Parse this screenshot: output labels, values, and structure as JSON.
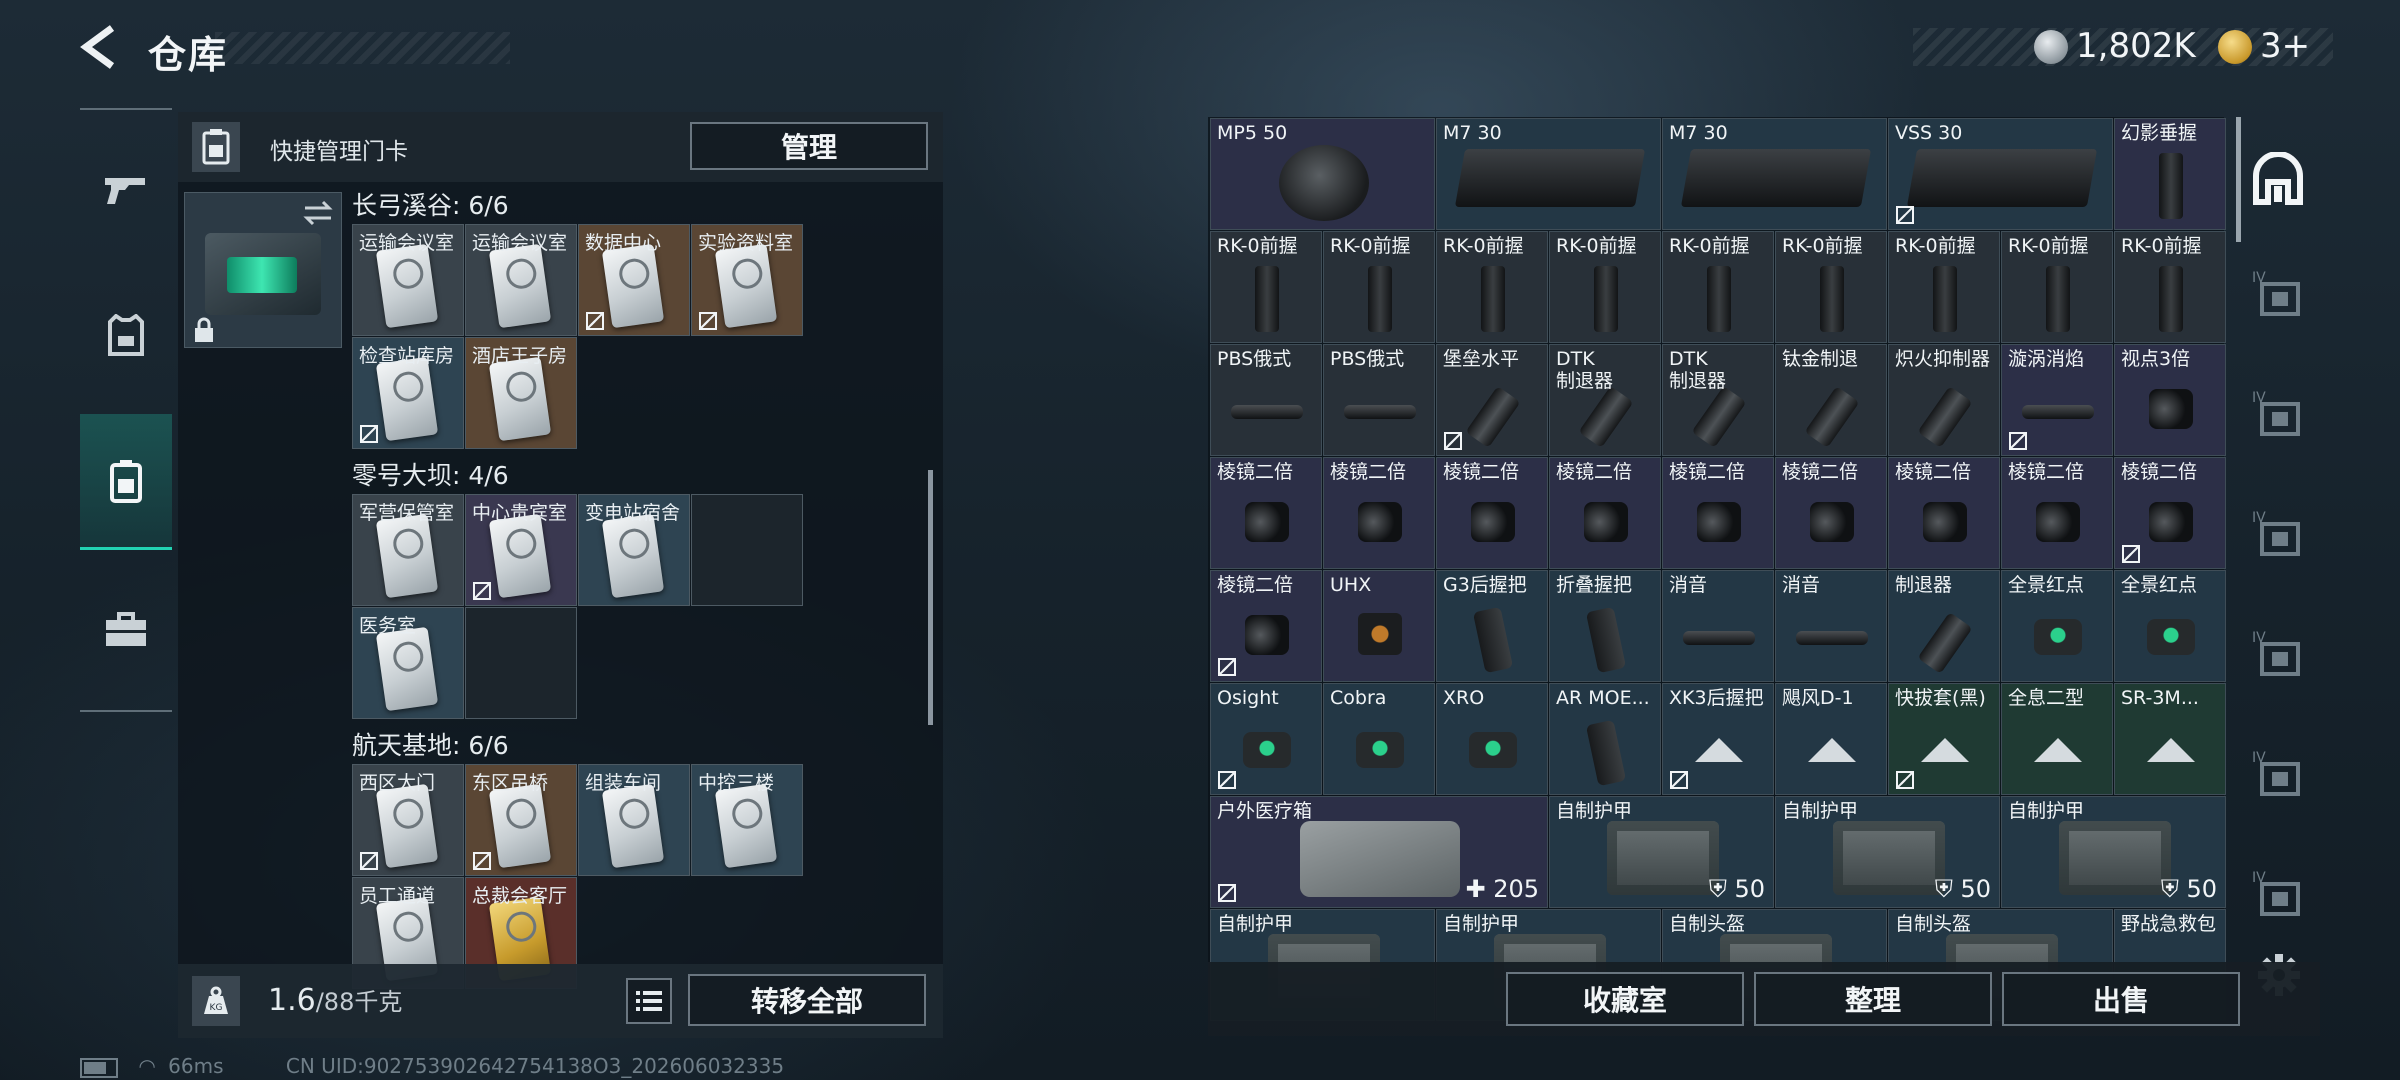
{
  "header": {
    "title": "仓库"
  },
  "currency": {
    "main": "1,802K",
    "tokens": "3+"
  },
  "left_panel": {
    "manage_label": "快捷管理门卡",
    "manage_button": "管理",
    "groups": [
      {
        "title": "长弓溪谷: 6/6",
        "cards": [
          {
            "label": "运输会议室",
            "tint": "gray",
            "locked": false
          },
          {
            "label": "运输会议室",
            "tint": "gray",
            "locked": false
          },
          {
            "label": "数据中心",
            "tint": "brown",
            "locked": true
          },
          {
            "label": "实验资料室",
            "tint": "brown",
            "locked": true
          },
          {
            "label": "检查站库房",
            "tint": "blue",
            "locked": true
          },
          {
            "label": "酒店王子房",
            "tint": "brown",
            "locked": false
          }
        ]
      },
      {
        "title": "零号大坝: 4/6",
        "cards": [
          {
            "label": "军营保管室",
            "tint": "gray",
            "locked": false
          },
          {
            "label": "中心贵宾室",
            "tint": "purple",
            "locked": true
          },
          {
            "label": "变电站宿舍",
            "tint": "blue",
            "locked": false
          },
          {
            "label": "",
            "tint": "empty",
            "locked": false
          },
          {
            "label": "医务室",
            "tint": "blue",
            "locked": false
          },
          {
            "label": "",
            "tint": "empty",
            "locked": false
          }
        ]
      },
      {
        "title": "航天基地: 6/6",
        "cards": [
          {
            "label": "西区大门",
            "tint": "gray",
            "locked": true
          },
          {
            "label": "东区吊桥",
            "tint": "brown",
            "locked": true
          },
          {
            "label": "组装车间",
            "tint": "blue",
            "locked": false
          },
          {
            "label": "中控三楼",
            "tint": "blue",
            "locked": false
          },
          {
            "label": "员工通道",
            "tint": "gray",
            "locked": false
          },
          {
            "label": "总裁会客厅",
            "tint": "red",
            "locked": false,
            "gold": true
          }
        ]
      }
    ],
    "weight_value": "1.6",
    "weight_cap": "/88千克",
    "transfer_all": "转移全部"
  },
  "grid": {
    "rows": [
      [
        {
          "label": "MP5 50",
          "bg": "purple",
          "locked": false,
          "span": 2,
          "obj": "drum"
        },
        {
          "label": "M7 30",
          "bg": "blue",
          "locked": false,
          "span": 2,
          "obj": "mag"
        },
        {
          "label": "M7 30",
          "bg": "blue",
          "locked": false,
          "span": 2,
          "obj": "mag"
        },
        {
          "label": "VSS 30",
          "bg": "blue",
          "locked": true,
          "span": 2,
          "obj": "mag"
        },
        {
          "label": "幻影垂握",
          "bg": "purple",
          "locked": false,
          "span": 1,
          "obj": "grip"
        }
      ],
      [
        {
          "label": "RK-0前握",
          "bg": "gray",
          "locked": false,
          "span": 1,
          "obj": "grip"
        },
        {
          "label": "RK-0前握",
          "bg": "gray",
          "locked": false,
          "span": 1,
          "obj": "grip"
        },
        {
          "label": "RK-0前握",
          "bg": "gray",
          "locked": false,
          "span": 1,
          "obj": "grip"
        },
        {
          "label": "RK-0前握",
          "bg": "gray",
          "locked": false,
          "span": 1,
          "obj": "grip"
        },
        {
          "label": "RK-0前握",
          "bg": "gray",
          "locked": false,
          "span": 1,
          "obj": "grip"
        },
        {
          "label": "RK-0前握",
          "bg": "gray",
          "locked": false,
          "span": 1,
          "obj": "grip"
        },
        {
          "label": "RK-0前握",
          "bg": "gray",
          "locked": false,
          "span": 1,
          "obj": "grip"
        },
        {
          "label": "RK-0前握",
          "bg": "gray",
          "locked": false,
          "span": 1,
          "obj": "grip"
        },
        {
          "label": "RK-0前握",
          "bg": "gray",
          "locked": false,
          "span": 1,
          "obj": "grip"
        }
      ],
      [
        {
          "label": "PBS俄式",
          "bg": "gray",
          "locked": false,
          "span": 1,
          "obj": "tube"
        },
        {
          "label": "PBS俄式",
          "bg": "gray",
          "locked": false,
          "span": 1,
          "obj": "tube"
        },
        {
          "label": "堡垒水平",
          "bg": "gray",
          "locked": true,
          "span": 1,
          "obj": "brake"
        },
        {
          "label": "DTK\n制退器",
          "bg": "gray",
          "locked": false,
          "span": 1,
          "obj": "brake"
        },
        {
          "label": "DTK\n制退器",
          "bg": "gray",
          "locked": false,
          "span": 1,
          "obj": "brake"
        },
        {
          "label": "钛金制退",
          "bg": "gray",
          "locked": false,
          "span": 1,
          "obj": "brake"
        },
        {
          "label": "炽火抑制器",
          "bg": "gray",
          "locked": false,
          "span": 1,
          "obj": "brake"
        },
        {
          "label": "漩涡消焰",
          "bg": "purple",
          "locked": true,
          "span": 1,
          "obj": "tube"
        },
        {
          "label": "视点3倍",
          "bg": "purple",
          "locked": false,
          "span": 1,
          "obj": "scope"
        }
      ],
      [
        {
          "label": "棱镜二倍",
          "bg": "purple",
          "locked": false,
          "span": 1,
          "obj": "scope"
        },
        {
          "label": "棱镜二倍",
          "bg": "purple",
          "locked": false,
          "span": 1,
          "obj": "scope"
        },
        {
          "label": "棱镜二倍",
          "bg": "purple",
          "locked": false,
          "span": 1,
          "obj": "scope"
        },
        {
          "label": "棱镜二倍",
          "bg": "purple",
          "locked": false,
          "span": 1,
          "obj": "scope"
        },
        {
          "label": "棱镜二倍",
          "bg": "purple",
          "locked": false,
          "span": 1,
          "obj": "scope"
        },
        {
          "label": "棱镜二倍",
          "bg": "purple",
          "locked": false,
          "span": 1,
          "obj": "scope"
        },
        {
          "label": "棱镜二倍",
          "bg": "purple",
          "locked": false,
          "span": 1,
          "obj": "scope"
        },
        {
          "label": "棱镜二倍",
          "bg": "purple",
          "locked": false,
          "span": 1,
          "obj": "scope"
        },
        {
          "label": "棱镜二倍",
          "bg": "purple",
          "locked": true,
          "span": 1,
          "obj": "scope"
        }
      ],
      [
        {
          "label": "棱镜二倍",
          "bg": "purple",
          "locked": true,
          "span": 1,
          "obj": "scope"
        },
        {
          "label": "UHX",
          "bg": "purple",
          "locked": false,
          "span": 1,
          "obj": "sight"
        },
        {
          "label": "G3后握把",
          "bg": "blue",
          "locked": false,
          "span": 1,
          "obj": "pgrip"
        },
        {
          "label": "折叠握把",
          "bg": "blue",
          "locked": false,
          "span": 1,
          "obj": "pgrip"
        },
        {
          "label": "消音",
          "bg": "blue",
          "locked": false,
          "span": 1,
          "obj": "tube"
        },
        {
          "label": "消音",
          "bg": "blue",
          "locked": false,
          "span": 1,
          "obj": "tube"
        },
        {
          "label": "制退器",
          "bg": "blue",
          "locked": false,
          "span": 1,
          "obj": "brake"
        },
        {
          "label": "全景红点",
          "bg": "blue",
          "locked": false,
          "span": 1,
          "obj": "holo"
        },
        {
          "label": "全景红点",
          "bg": "blue",
          "locked": false,
          "span": 1,
          "obj": "holo"
        }
      ],
      [
        {
          "label": "Osight",
          "bg": "blue",
          "locked": true,
          "span": 1,
          "obj": "holo"
        },
        {
          "label": "Cobra",
          "bg": "blue",
          "locked": false,
          "span": 1,
          "obj": "holo"
        },
        {
          "label": "XRO",
          "bg": "blue",
          "locked": false,
          "span": 1,
          "obj": "holo"
        },
        {
          "label": "AR MOE...",
          "bg": "blue",
          "locked": false,
          "span": 1,
          "obj": "pgrip"
        },
        {
          "label": "XK3后握把",
          "bg": "blue",
          "locked": true,
          "span": 1,
          "obj": "tri"
        },
        {
          "label": "飓风D-1",
          "bg": "blue",
          "locked": false,
          "span": 1,
          "obj": "tri"
        },
        {
          "label": "快拔套(黑)",
          "bg": "green",
          "locked": true,
          "span": 1,
          "obj": "tri"
        },
        {
          "label": "全息二型",
          "bg": "green",
          "locked": false,
          "span": 1,
          "obj": "tri"
        },
        {
          "label": "SR-3M...",
          "bg": "green",
          "locked": false,
          "span": 1,
          "obj": "tri"
        }
      ],
      [
        {
          "label": "户外医疗箱",
          "bg": "purple",
          "locked": true,
          "span": 3,
          "obj": "medkit",
          "count": "205",
          "count_icon": "plus"
        },
        {
          "label": "自制护甲",
          "bg": "blue",
          "locked": false,
          "span": 2,
          "obj": "armor",
          "count": "50",
          "count_icon": "shield"
        },
        {
          "label": "自制护甲",
          "bg": "blue",
          "locked": false,
          "span": 2,
          "obj": "armor",
          "count": "50",
          "count_icon": "shield"
        },
        {
          "label": "自制护甲",
          "bg": "blue",
          "locked": false,
          "span": 2,
          "obj": "armor",
          "count": "50",
          "count_icon": "shield"
        }
      ],
      [
        {
          "label": "自制护甲",
          "bg": "blue",
          "locked": false,
          "span": 2,
          "obj": "armor"
        },
        {
          "label": "自制护甲",
          "bg": "blue",
          "locked": false,
          "span": 2,
          "obj": "armor"
        },
        {
          "label": "自制头盔",
          "bg": "blue",
          "locked": false,
          "span": 2,
          "obj": "armor"
        },
        {
          "label": "自制头盔",
          "bg": "blue",
          "locked": false,
          "span": 2,
          "obj": "armor"
        },
        {
          "label": "野战急救包",
          "bg": "blue",
          "locked": false,
          "span": 1,
          "obj": "none"
        }
      ]
    ]
  },
  "footer_buttons": {
    "collection": "收藏室",
    "organize": "整理",
    "sell": "出售"
  },
  "status_bar": {
    "ping": "66ms",
    "uid": "CN UID:902753902642754138O3_202606032335"
  },
  "colors": {
    "accent": "#22d3b3",
    "purple_cell": "#2c2f47",
    "blue_cell": "#233745",
    "green_cell": "#1f3a33"
  }
}
